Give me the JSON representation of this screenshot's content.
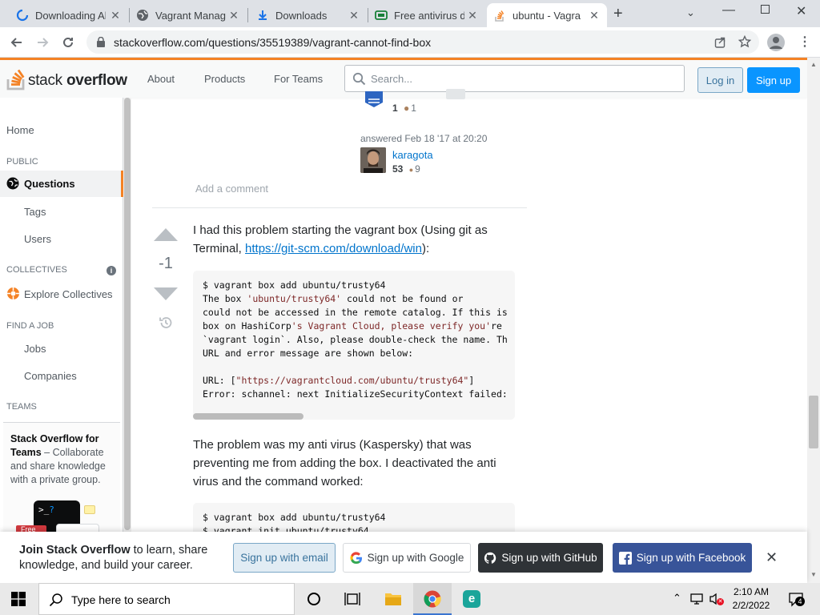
{
  "browser": {
    "tabs": [
      {
        "title": "Downloading Al",
        "icon": "refresh-icon"
      },
      {
        "title": "Vagrant Manag",
        "icon": "globe-icon"
      },
      {
        "title": "Downloads",
        "icon": "download-icon"
      },
      {
        "title": "Free antivirus d",
        "icon": "card-icon"
      },
      {
        "title": "ubuntu - Vagra",
        "icon": "stackoverflow-icon",
        "active": true
      }
    ],
    "url": "stackoverflow.com/questions/35519389/vagrant-cannot-find-box"
  },
  "so_header": {
    "logo_text_1": "stack",
    "logo_text_2": "overflow",
    "nav": [
      "About",
      "Products",
      "For Teams"
    ],
    "search_placeholder": "Search...",
    "login": "Log in",
    "signup": "Sign up"
  },
  "sidebar": {
    "home": "Home",
    "public_head": "PUBLIC",
    "questions": "Questions",
    "tags": "Tags",
    "users": "Users",
    "collectives_head": "COLLECTIVES",
    "explore_collectives": "Explore Collectives",
    "find_job_head": "FIND A JOB",
    "jobs": "Jobs",
    "companies": "Companies",
    "teams_head": "TEAMS",
    "teams_title": "Stack Overflow for Teams",
    "teams_dash": " – ",
    "teams_desc": "Collaborate and share knowledge with a private group.",
    "teams_badge": "Free"
  },
  "prev_answer": {
    "partial_rep": "1",
    "partial_badge": "1",
    "answered": "answered Feb 18 '17 at 20:20",
    "user": "karagota",
    "rep": "53",
    "bronze": "9",
    "add_comment": "Add a comment"
  },
  "answer": {
    "score": "-1",
    "para1_prefix": "I had this problem starting the vagrant box (Using git as Terminal, ",
    "para1_link": "https://git-scm.com/download/win",
    "para1_suffix": "):",
    "code1": [
      {
        "t": "$ vagrant box add ubuntu/trusty64"
      },
      {
        "t": "The box ",
        "s": "'ubuntu/trusty64'",
        "e": " could not be found or"
      },
      {
        "t": "could not be accessed in the remote catalog. If this is"
      },
      {
        "t": "box on HashiCorp",
        "s": "'s Vagrant Cloud, please verify you'",
        "e": "re"
      },
      {
        "t": "`vagrant login`. Also, please double-check the name. Th"
      },
      {
        "t": "URL and error message are shown below:"
      },
      {
        "t": ""
      },
      {
        "t": "URL: [",
        "s": "\"https://vagrantcloud.com/ubuntu/trusty64\"",
        "e": "]"
      },
      {
        "t": "Error: schannel: next InitializeSecurityContext failed:"
      }
    ],
    "para2": "The problem was my anti virus (Kaspersky) that was preventing me from adding the box. I deactivated the anti virus and the command worked:",
    "code2_line1": "$ vagrant box add ubuntu/trusty64",
    "code2_line2": "$ vagrant init ubuntu/trusty64"
  },
  "banner": {
    "bold": "Join Stack Overflow",
    "text": " to learn, share knowledge, and build your career.",
    "email": "Sign up with email",
    "google": "Sign up with Google",
    "github": "Sign up with GitHub",
    "facebook": "Sign up with Facebook"
  },
  "taskbar": {
    "search": "Type here to search",
    "time": "2:10 AM",
    "date": "2/2/2022",
    "notif_count": "4"
  },
  "colors": {
    "so_orange": "#f48225",
    "so_blue": "#0a95ff",
    "github": "#2f3337",
    "facebook": "#385499"
  }
}
